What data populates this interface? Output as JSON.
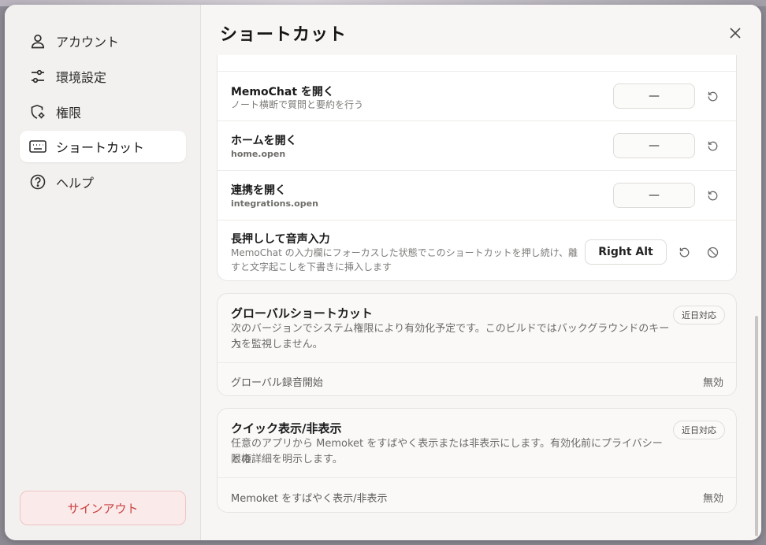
{
  "sidebar": {
    "items": [
      {
        "label": "アカウント",
        "icon": "person-icon"
      },
      {
        "label": "環境設定",
        "icon": "sliders-icon"
      },
      {
        "label": "権限",
        "icon": "shield-gear-icon"
      },
      {
        "label": "ショートカット",
        "icon": "keyboard-icon",
        "active": true
      },
      {
        "label": "ヘルプ",
        "icon": "help-circle-icon"
      }
    ],
    "signout_label": "サインアウト"
  },
  "header": {
    "title": "ショートカット"
  },
  "shortcuts": {
    "rows": [
      {
        "title": "MemoChat を開く",
        "desc": "ノート横断で質問と要約を行う",
        "key": "—"
      },
      {
        "title": "ホームを開く",
        "desc": "home.open",
        "key": "—"
      },
      {
        "title": "連携を開く",
        "desc": "integrations.open",
        "key": "—"
      },
      {
        "title": "長押しして音声入力",
        "desc_line1": "MemoChat の入力欄にフォーカスした状態でこのショートカットを押し続け、離",
        "desc_line2": "すと文字起こしを下書きに挿入します",
        "key": "Right Alt"
      }
    ]
  },
  "global_shortcuts": {
    "title": "グローバルショートカット",
    "badge": "近日対応",
    "desc_line1": "次のバージョンでシステム権限により有効化予定です。このビルドではバックグラウンドのキー入",
    "desc_line2": "力を監視しません。",
    "setting_label": "グローバル録音開始",
    "setting_value": "無効"
  },
  "quick_toggle": {
    "title": "クイック表示/非表示",
    "badge": "近日対応",
    "desc_line1": "任意のアプリから Memoket をすばやく表示または非表示にします。有効化前にプライバシーと権",
    "desc_line2": "限の詳細を明示します。",
    "setting_label": "Memoket をすばやく表示/非表示",
    "setting_value": "無効"
  },
  "colors": {
    "accent_danger": "#c9413f",
    "sidebar_bg": "#f2f1ef",
    "main_bg": "#f7f6f5"
  }
}
